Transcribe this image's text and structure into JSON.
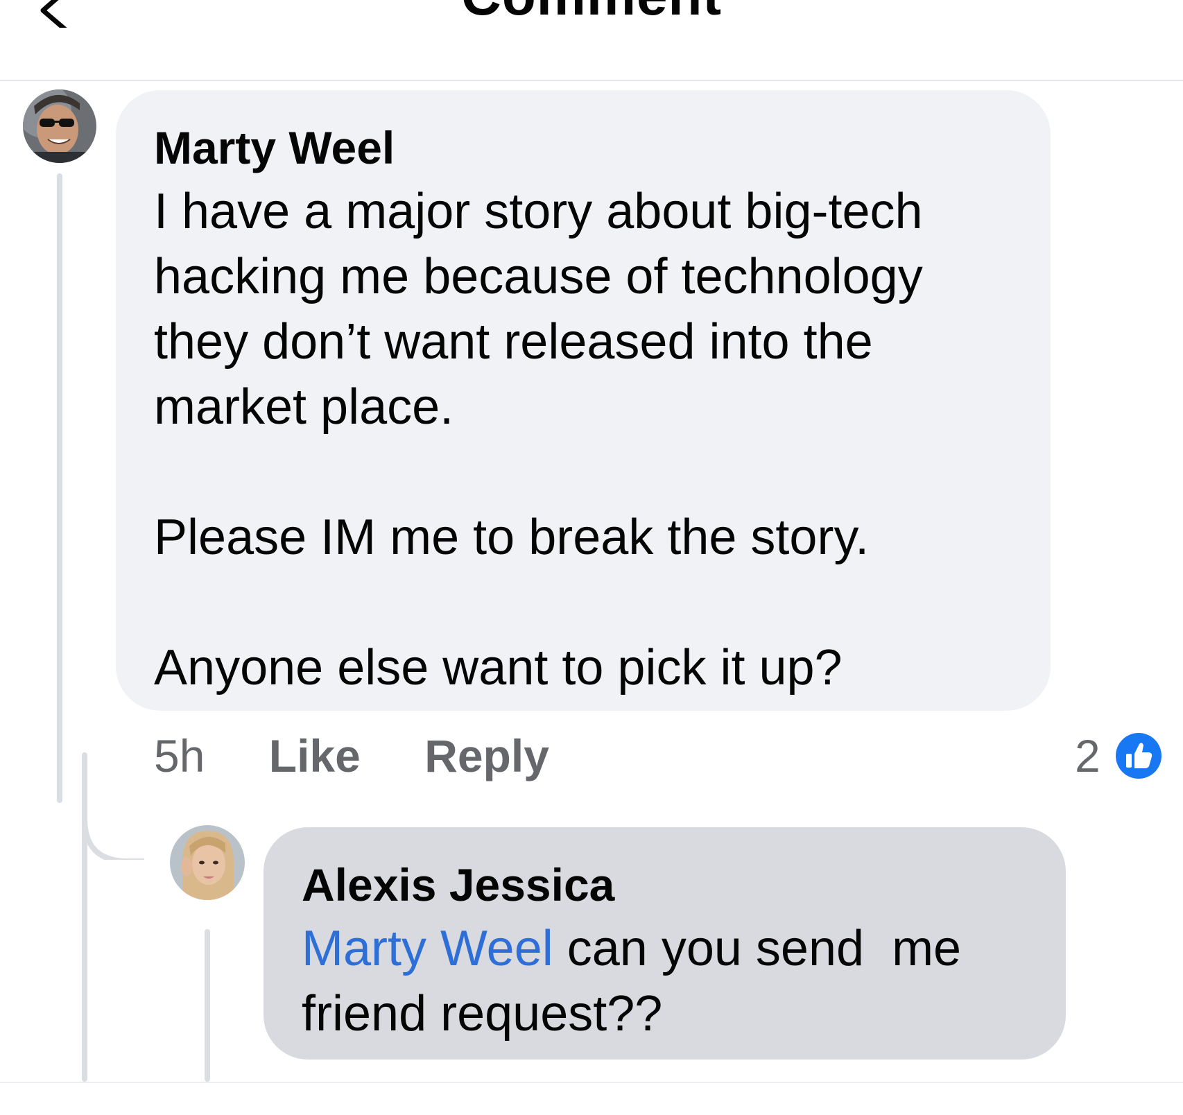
{
  "header": {
    "title": "Comment",
    "back_icon": "chevron-left-icon"
  },
  "comment": {
    "author": "Marty Weel",
    "text": "I have a major story about big-tech hacking me because of technology they don’t want released into the market place.\n\nPlease IM me to break the story.\n\nAnyone else want to pick it up?",
    "time": "5h",
    "like_label": "Like",
    "reply_label": "Reply",
    "reaction_count": "2",
    "reaction_icon": "thumbs-up-icon"
  },
  "reply": {
    "author": "Alexis Jessica",
    "mention": "Marty Weel",
    "text": " can you send  me friend request??"
  },
  "colors": {
    "bubble_main": "#f0f2f5",
    "bubble_reply": "#d8dadf",
    "mention": "#2d6fd6",
    "like_blue": "#1877f2",
    "secondary_text": "#65676b"
  }
}
